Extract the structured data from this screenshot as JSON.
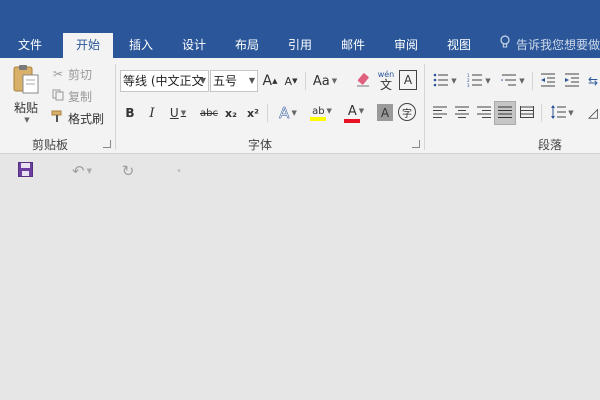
{
  "tabs": [
    {
      "label": "文件",
      "active": false
    },
    {
      "label": "开始",
      "active": true
    },
    {
      "label": "插入",
      "active": false
    },
    {
      "label": "设计",
      "active": false
    },
    {
      "label": "布局",
      "active": false
    },
    {
      "label": "引用",
      "active": false
    },
    {
      "label": "邮件",
      "active": false
    },
    {
      "label": "审阅",
      "active": false
    },
    {
      "label": "视图",
      "active": false
    }
  ],
  "tell_me": "告诉我您想要做",
  "clipboard": {
    "group_label": "剪贴板",
    "paste_label": "粘贴",
    "cut_label": "剪切",
    "copy_label": "复制",
    "format_painter_label": "格式刷"
  },
  "font": {
    "group_label": "字体",
    "font_name": "等线 (中文正文",
    "font_size": "五号",
    "grow_label": "A",
    "shrink_label": "A",
    "case_label": "Aa",
    "phonetic_top": "wén",
    "phonetic_bottom": "文",
    "char_border_label": "A",
    "bold": "B",
    "italic": "I",
    "underline": "U",
    "strike": "abc",
    "subscript": "x₂",
    "superscript": "x²",
    "text_effects": "A",
    "highlight": "ab",
    "font_color": "A",
    "char_shading": "A",
    "enclose_char": "字"
  },
  "paragraph": {
    "group_label": "段落"
  },
  "colors": {
    "accent": "#2b579a",
    "ribbon": "#f3f3f3",
    "workspace": "#e6e6e6",
    "highlight_yellow": "#ffff00",
    "font_red": "#e81123",
    "save_purple": "#6b3fa0"
  },
  "qat": {
    "save_icon": "save-icon",
    "undo_icon": "undo-icon",
    "redo_icon": "redo-icon",
    "customize_icon": "customize-qat-icon"
  }
}
